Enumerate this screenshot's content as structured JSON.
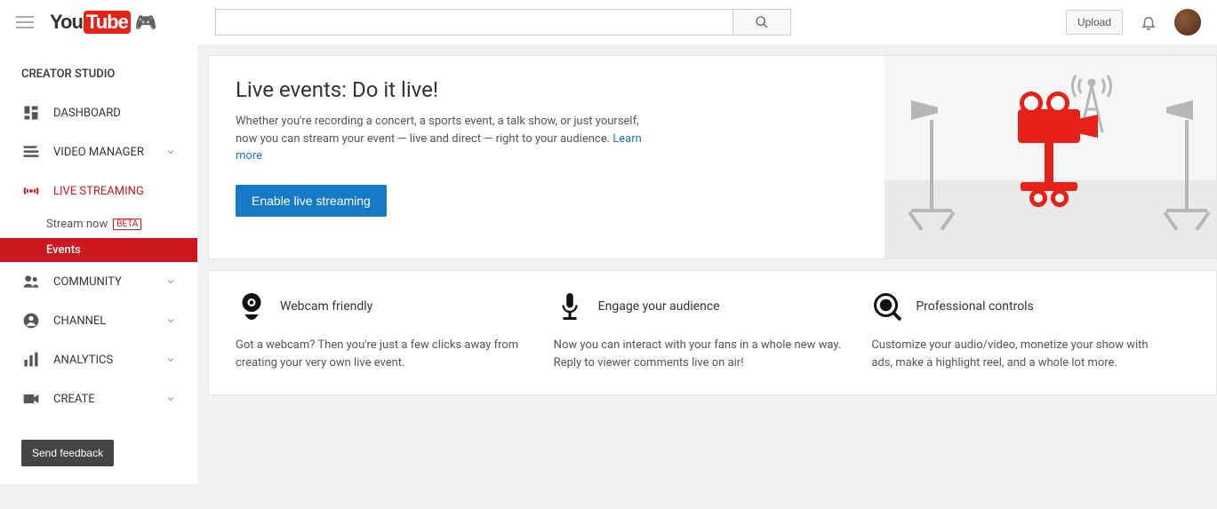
{
  "header": {
    "logo_you": "You",
    "logo_tube": "Tube",
    "search_placeholder": "",
    "upload_label": "Upload"
  },
  "sidebar": {
    "title": "CREATOR STUDIO",
    "items": [
      {
        "label": "DASHBOARD"
      },
      {
        "label": "VIDEO MANAGER"
      },
      {
        "label": "LIVE STREAMING"
      },
      {
        "label": "COMMUNITY"
      },
      {
        "label": "CHANNEL"
      },
      {
        "label": "ANALYTICS"
      },
      {
        "label": "CREATE"
      }
    ],
    "live_sub": {
      "stream_now": "Stream now",
      "beta": "BETA",
      "events": "Events"
    },
    "feedback": "Send feedback"
  },
  "hero": {
    "title": "Live events: Do it live!",
    "desc": "Whether you're recording a concert, a sports event, a talk show, or just yourself, now you can stream your event — live and direct — right to your audience. ",
    "learn_more": "Learn more",
    "button": "Enable live streaming"
  },
  "features": [
    {
      "title": "Webcam friendly",
      "desc": "Got a webcam? Then you're just a few clicks away from creating your very own live event."
    },
    {
      "title": "Engage your audience",
      "desc": "Now you can interact with your fans in a whole new way. Reply to viewer comments live on air!"
    },
    {
      "title": "Professional controls",
      "desc": "Customize your audio/video, monetize your show with ads, make a highlight reel, and a whole lot more."
    }
  ]
}
